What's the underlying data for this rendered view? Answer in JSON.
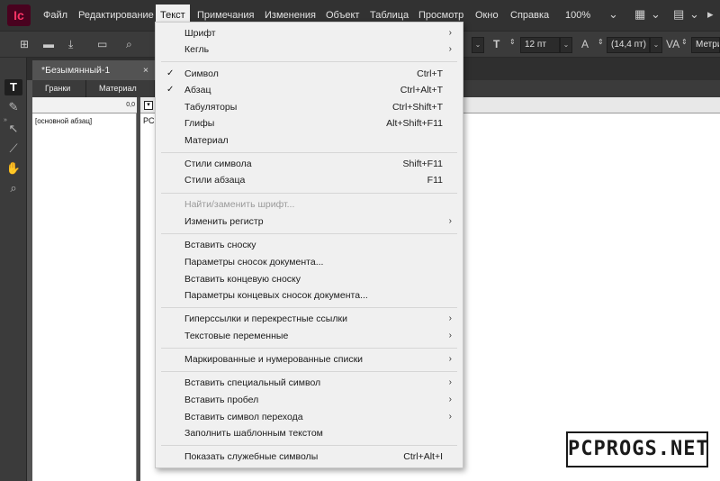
{
  "app": {
    "logo_text": "Ic"
  },
  "menubar": {
    "items": [
      "Файл",
      "Редактирование",
      "Текст",
      "Примечания",
      "Изменения",
      "Объект",
      "Таблица",
      "Просмотр",
      "Окно",
      "Справка"
    ],
    "active": "Текст",
    "zoom": "100%"
  },
  "controlbar": {
    "font_size": "12 пт",
    "leading": "(14,4 пт)",
    "kerning": "Метрич"
  },
  "document": {
    "tab_title": "*Безымянный-1",
    "tab_close": "×"
  },
  "story_editor": {
    "tabs": [
      "Гранки",
      "Материал"
    ],
    "ruler_value": "0,0",
    "paragraph_style": "[основной абзац]",
    "text_start": "PCF"
  },
  "dropdown": {
    "items": [
      {
        "label": "Шрифт",
        "submenu": true
      },
      {
        "label": "Кегль",
        "submenu": true
      },
      {
        "label": "Символ",
        "shortcut": "Ctrl+T",
        "checked": true
      },
      {
        "label": "Абзац",
        "shortcut": "Ctrl+Alt+T",
        "checked": true
      },
      {
        "label": "Табуляторы",
        "shortcut": "Ctrl+Shift+T"
      },
      {
        "label": "Глифы",
        "shortcut": "Alt+Shift+F11"
      },
      {
        "label": "Материал"
      },
      {
        "label": "Стили символа",
        "shortcut": "Shift+F11"
      },
      {
        "label": "Стили абзаца",
        "shortcut": "F11"
      },
      {
        "label": "Найти/заменить шрифт...",
        "disabled": true
      },
      {
        "label": "Изменить регистр",
        "submenu": true
      },
      {
        "label": "Вставить сноску"
      },
      {
        "label": "Параметры сносок документа..."
      },
      {
        "label": "Вставить концевую сноску"
      },
      {
        "label": "Параметры концевых сносок документа..."
      },
      {
        "label": "Гиперссылки и перекрестные ссылки",
        "submenu": true
      },
      {
        "label": "Текстовые переменные",
        "submenu": true
      },
      {
        "label": "Маркированные и нумерованные списки",
        "submenu": true
      },
      {
        "label": "Вставить специальный символ",
        "submenu": true
      },
      {
        "label": "Вставить пробел",
        "submenu": true
      },
      {
        "label": "Вставить символ перехода",
        "submenu": true
      },
      {
        "label": "Заполнить шаблонным текстом"
      },
      {
        "label": "Показать служебные символы",
        "shortcut": "Ctrl+Alt+I"
      }
    ],
    "check_glyph": "✓",
    "submenu_glyph": "›"
  },
  "watermark": "PCPROGS.NET"
}
